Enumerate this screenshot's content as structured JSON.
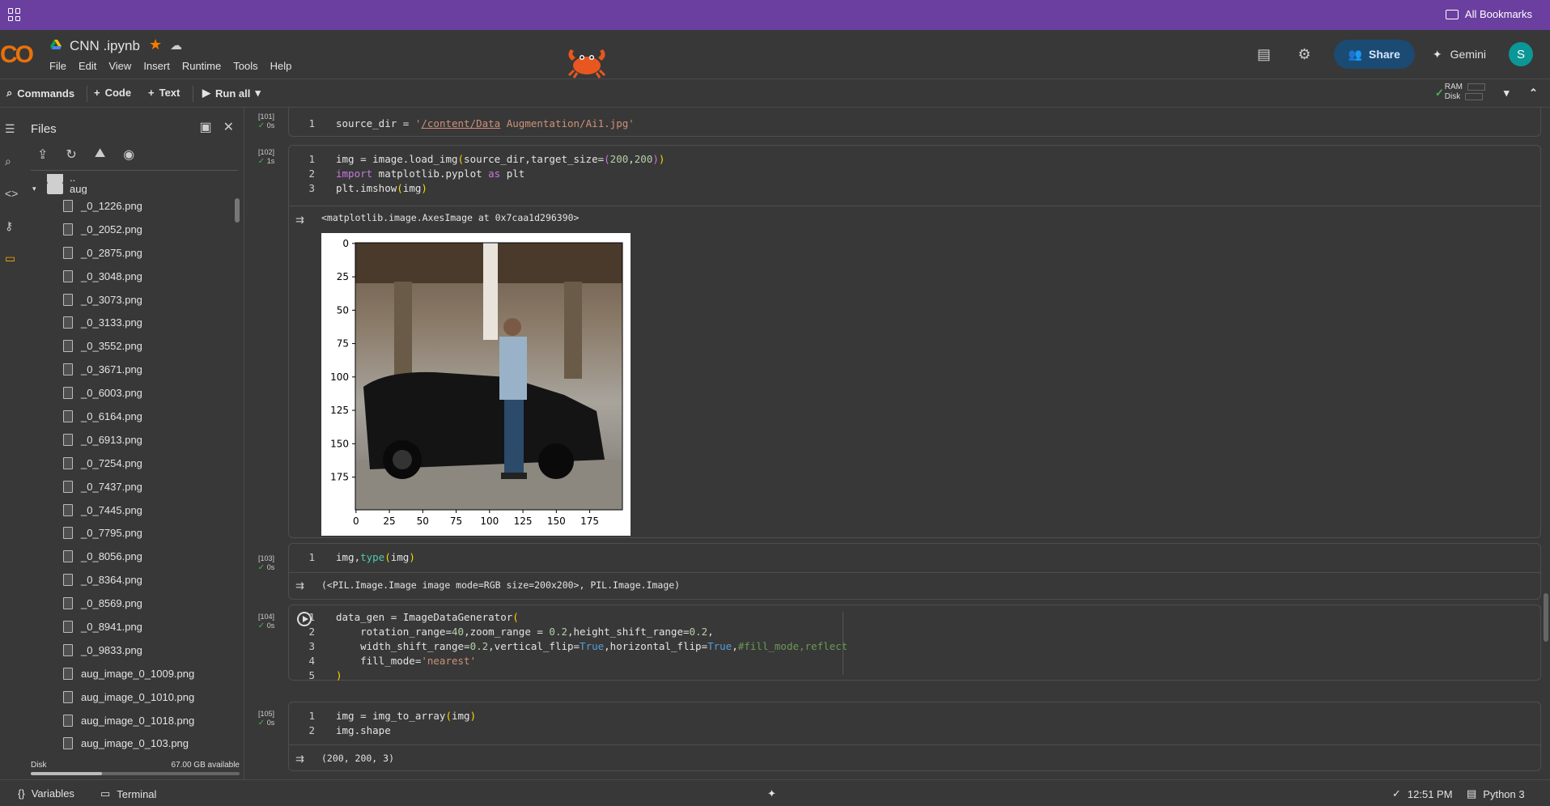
{
  "bookmarks": {
    "all_label": "All Bookmarks"
  },
  "header": {
    "logo": "CO",
    "notebook_title": "CNN .ipynb",
    "menu": [
      "File",
      "Edit",
      "View",
      "Insert",
      "Runtime",
      "Tools",
      "Help"
    ],
    "share_label": "Share",
    "gemini_label": "Gemini",
    "avatar_letter": "S"
  },
  "toolbar": {
    "commands": "Commands",
    "code": "Code",
    "text": "Text",
    "run_all": "Run all",
    "ram": "RAM",
    "disk": "Disk"
  },
  "files": {
    "title": "Files",
    "parent": "..",
    "folder": "aug",
    "items": [
      "_0_1226.png",
      "_0_2052.png",
      "_0_2875.png",
      "_0_3048.png",
      "_0_3073.png",
      "_0_3133.png",
      "_0_3552.png",
      "_0_3671.png",
      "_0_6003.png",
      "_0_6164.png",
      "_0_6913.png",
      "_0_7254.png",
      "_0_7437.png",
      "_0_7445.png",
      "_0_7795.png",
      "_0_8056.png",
      "_0_8364.png",
      "_0_8569.png",
      "_0_8941.png",
      "_0_9833.png",
      "aug_image_0_1009.png",
      "aug_image_0_1010.png",
      "aug_image_0_1018.png",
      "aug_image_0_103.png"
    ],
    "disk_label": "Disk",
    "disk_available": "67.00 GB available",
    "disk_used_fraction": 0.34
  },
  "cells": [
    {
      "exec": "[101]",
      "time": "0s"
    },
    {
      "exec": "[102]",
      "time": "1s",
      "output": "<matplotlib.image.AxesImage at 0x7caa1d296390>"
    },
    {
      "exec": "[103]",
      "time": "0s",
      "output": "(<PIL.Image.Image image mode=RGB size=200x200>, PIL.Image.Image)"
    },
    {
      "exec": "[104]",
      "time": "0s"
    },
    {
      "exec": "[105]",
      "time": "0s",
      "output": "(200, 200, 3)"
    }
  ],
  "plot": {
    "y_ticks": [
      "0",
      "25",
      "50",
      "75",
      "100",
      "125",
      "150",
      "175"
    ],
    "x_ticks": [
      "0",
      "25",
      "50",
      "75",
      "100",
      "125",
      "150",
      "175"
    ]
  },
  "status": {
    "variables": "Variables",
    "terminal": "Terminal",
    "time": "12:51 PM",
    "runtime": "Python 3"
  },
  "colors": {
    "bookmarks_bar": "#6b3fa0",
    "share_button": "#1b4a73",
    "avatar": "#0a9796",
    "logo_orange": "#f9ab00",
    "background": "#383838"
  }
}
